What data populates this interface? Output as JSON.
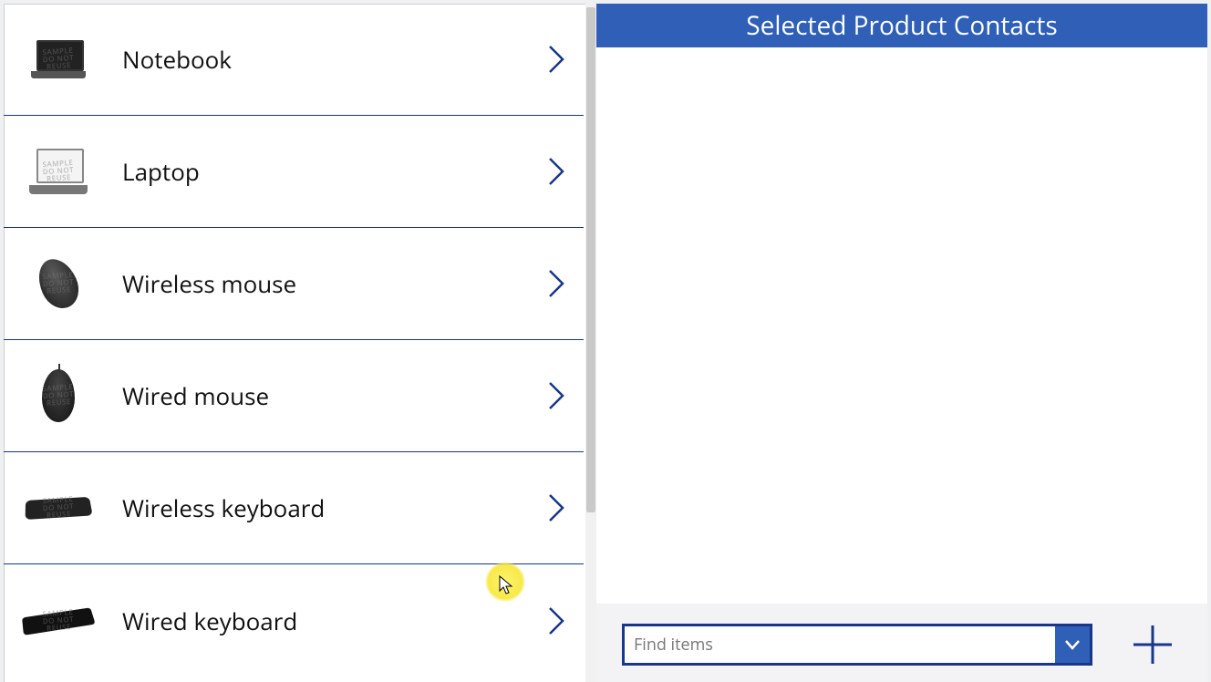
{
  "products": [
    {
      "label": "Notebook",
      "icon": "notebook-icon"
    },
    {
      "label": "Laptop",
      "icon": "laptop-icon"
    },
    {
      "label": "Wireless mouse",
      "icon": "wireless-mouse-icon"
    },
    {
      "label": "Wired mouse",
      "icon": "wired-mouse-icon"
    },
    {
      "label": "Wireless keyboard",
      "icon": "wireless-keyboard-icon"
    },
    {
      "label": "Wired keyboard",
      "icon": "wired-keyboard-icon"
    }
  ],
  "right": {
    "header": "Selected Product Contacts",
    "find_placeholder": "Find items"
  },
  "watermark": "SAMPLE\nDO NOT REUSE"
}
